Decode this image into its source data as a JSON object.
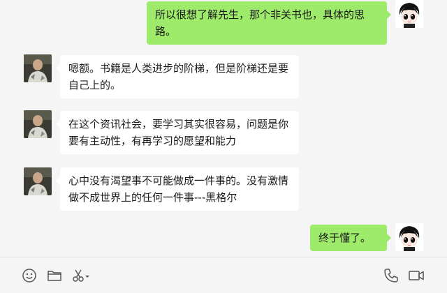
{
  "chat": {
    "messages": [
      {
        "sender": "self",
        "avatar_icon": "cartoon-avatar-icon",
        "text": "所以很想了解先生，那个非关书也，具体的思路。"
      },
      {
        "sender": "other",
        "avatar_icon": "photo-avatar-icon",
        "text": "嗯额。书籍是人类进步的阶梯，但是阶梯还是要自己上的。"
      },
      {
        "sender": "other",
        "avatar_icon": "photo-avatar-icon",
        "text": "在这个资讯社会，要学习其实很容易，问题是你要有主动性，有再学习的愿望和能力"
      },
      {
        "sender": "other",
        "avatar_icon": "photo-avatar-icon",
        "text": "心中没有渴望事不可能做成一件事的。没有激情做不成世界上的任何一件事---黑格尔"
      },
      {
        "sender": "self",
        "avatar_icon": "cartoon-avatar-icon",
        "text": "终于懂了。"
      }
    ]
  },
  "toolbar": {
    "left_icons": [
      "emoji-icon",
      "folder-icon",
      "scissors-icon",
      "chevron-down-icon"
    ],
    "right_icons": [
      "phone-icon",
      "video-icon"
    ]
  },
  "colors": {
    "outgoing_bubble": "#9eea6a",
    "incoming_bubble": "#ffffff",
    "background": "#f5f5f5"
  }
}
